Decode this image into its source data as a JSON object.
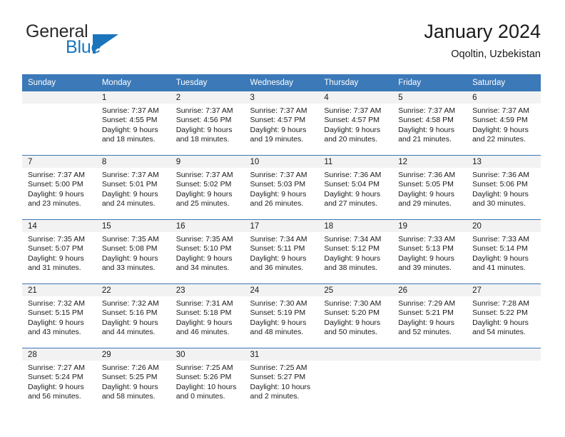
{
  "brand": {
    "name_part1": "General",
    "name_part2": "Blue",
    "logo_icon": "triangle-flag-icon",
    "accent_color": "#1B75BC"
  },
  "header": {
    "title": "January 2024",
    "subtitle": "Oqoltin, Uzbekistan"
  },
  "theme": {
    "header_row_color": "#3B79B8",
    "daynum_band_color": "#F2F2F2",
    "text_color": "#1a1a1a"
  },
  "calendar": {
    "weekday_headers": [
      "Sunday",
      "Monday",
      "Tuesday",
      "Wednesday",
      "Thursday",
      "Friday",
      "Saturday"
    ],
    "weeks": [
      [
        {
          "day": "",
          "sunrise": "",
          "sunset": "",
          "daylight": ""
        },
        {
          "day": "1",
          "sunrise": "Sunrise: 7:37 AM",
          "sunset": "Sunset: 4:55 PM",
          "daylight": "Daylight: 9 hours and 18 minutes."
        },
        {
          "day": "2",
          "sunrise": "Sunrise: 7:37 AM",
          "sunset": "Sunset: 4:56 PM",
          "daylight": "Daylight: 9 hours and 18 minutes."
        },
        {
          "day": "3",
          "sunrise": "Sunrise: 7:37 AM",
          "sunset": "Sunset: 4:57 PM",
          "daylight": "Daylight: 9 hours and 19 minutes."
        },
        {
          "day": "4",
          "sunrise": "Sunrise: 7:37 AM",
          "sunset": "Sunset: 4:57 PM",
          "daylight": "Daylight: 9 hours and 20 minutes."
        },
        {
          "day": "5",
          "sunrise": "Sunrise: 7:37 AM",
          "sunset": "Sunset: 4:58 PM",
          "daylight": "Daylight: 9 hours and 21 minutes."
        },
        {
          "day": "6",
          "sunrise": "Sunrise: 7:37 AM",
          "sunset": "Sunset: 4:59 PM",
          "daylight": "Daylight: 9 hours and 22 minutes."
        }
      ],
      [
        {
          "day": "7",
          "sunrise": "Sunrise: 7:37 AM",
          "sunset": "Sunset: 5:00 PM",
          "daylight": "Daylight: 9 hours and 23 minutes."
        },
        {
          "day": "8",
          "sunrise": "Sunrise: 7:37 AM",
          "sunset": "Sunset: 5:01 PM",
          "daylight": "Daylight: 9 hours and 24 minutes."
        },
        {
          "day": "9",
          "sunrise": "Sunrise: 7:37 AM",
          "sunset": "Sunset: 5:02 PM",
          "daylight": "Daylight: 9 hours and 25 minutes."
        },
        {
          "day": "10",
          "sunrise": "Sunrise: 7:37 AM",
          "sunset": "Sunset: 5:03 PM",
          "daylight": "Daylight: 9 hours and 26 minutes."
        },
        {
          "day": "11",
          "sunrise": "Sunrise: 7:36 AM",
          "sunset": "Sunset: 5:04 PM",
          "daylight": "Daylight: 9 hours and 27 minutes."
        },
        {
          "day": "12",
          "sunrise": "Sunrise: 7:36 AM",
          "sunset": "Sunset: 5:05 PM",
          "daylight": "Daylight: 9 hours and 29 minutes."
        },
        {
          "day": "13",
          "sunrise": "Sunrise: 7:36 AM",
          "sunset": "Sunset: 5:06 PM",
          "daylight": "Daylight: 9 hours and 30 minutes."
        }
      ],
      [
        {
          "day": "14",
          "sunrise": "Sunrise: 7:35 AM",
          "sunset": "Sunset: 5:07 PM",
          "daylight": "Daylight: 9 hours and 31 minutes."
        },
        {
          "day": "15",
          "sunrise": "Sunrise: 7:35 AM",
          "sunset": "Sunset: 5:08 PM",
          "daylight": "Daylight: 9 hours and 33 minutes."
        },
        {
          "day": "16",
          "sunrise": "Sunrise: 7:35 AM",
          "sunset": "Sunset: 5:10 PM",
          "daylight": "Daylight: 9 hours and 34 minutes."
        },
        {
          "day": "17",
          "sunrise": "Sunrise: 7:34 AM",
          "sunset": "Sunset: 5:11 PM",
          "daylight": "Daylight: 9 hours and 36 minutes."
        },
        {
          "day": "18",
          "sunrise": "Sunrise: 7:34 AM",
          "sunset": "Sunset: 5:12 PM",
          "daylight": "Daylight: 9 hours and 38 minutes."
        },
        {
          "day": "19",
          "sunrise": "Sunrise: 7:33 AM",
          "sunset": "Sunset: 5:13 PM",
          "daylight": "Daylight: 9 hours and 39 minutes."
        },
        {
          "day": "20",
          "sunrise": "Sunrise: 7:33 AM",
          "sunset": "Sunset: 5:14 PM",
          "daylight": "Daylight: 9 hours and 41 minutes."
        }
      ],
      [
        {
          "day": "21",
          "sunrise": "Sunrise: 7:32 AM",
          "sunset": "Sunset: 5:15 PM",
          "daylight": "Daylight: 9 hours and 43 minutes."
        },
        {
          "day": "22",
          "sunrise": "Sunrise: 7:32 AM",
          "sunset": "Sunset: 5:16 PM",
          "daylight": "Daylight: 9 hours and 44 minutes."
        },
        {
          "day": "23",
          "sunrise": "Sunrise: 7:31 AM",
          "sunset": "Sunset: 5:18 PM",
          "daylight": "Daylight: 9 hours and 46 minutes."
        },
        {
          "day": "24",
          "sunrise": "Sunrise: 7:30 AM",
          "sunset": "Sunset: 5:19 PM",
          "daylight": "Daylight: 9 hours and 48 minutes."
        },
        {
          "day": "25",
          "sunrise": "Sunrise: 7:30 AM",
          "sunset": "Sunset: 5:20 PM",
          "daylight": "Daylight: 9 hours and 50 minutes."
        },
        {
          "day": "26",
          "sunrise": "Sunrise: 7:29 AM",
          "sunset": "Sunset: 5:21 PM",
          "daylight": "Daylight: 9 hours and 52 minutes."
        },
        {
          "day": "27",
          "sunrise": "Sunrise: 7:28 AM",
          "sunset": "Sunset: 5:22 PM",
          "daylight": "Daylight: 9 hours and 54 minutes."
        }
      ],
      [
        {
          "day": "28",
          "sunrise": "Sunrise: 7:27 AM",
          "sunset": "Sunset: 5:24 PM",
          "daylight": "Daylight: 9 hours and 56 minutes."
        },
        {
          "day": "29",
          "sunrise": "Sunrise: 7:26 AM",
          "sunset": "Sunset: 5:25 PM",
          "daylight": "Daylight: 9 hours and 58 minutes."
        },
        {
          "day": "30",
          "sunrise": "Sunrise: 7:25 AM",
          "sunset": "Sunset: 5:26 PM",
          "daylight": "Daylight: 10 hours and 0 minutes."
        },
        {
          "day": "31",
          "sunrise": "Sunrise: 7:25 AM",
          "sunset": "Sunset: 5:27 PM",
          "daylight": "Daylight: 10 hours and 2 minutes."
        },
        {
          "day": "",
          "sunrise": "",
          "sunset": "",
          "daylight": ""
        },
        {
          "day": "",
          "sunrise": "",
          "sunset": "",
          "daylight": ""
        },
        {
          "day": "",
          "sunrise": "",
          "sunset": "",
          "daylight": ""
        }
      ]
    ]
  }
}
